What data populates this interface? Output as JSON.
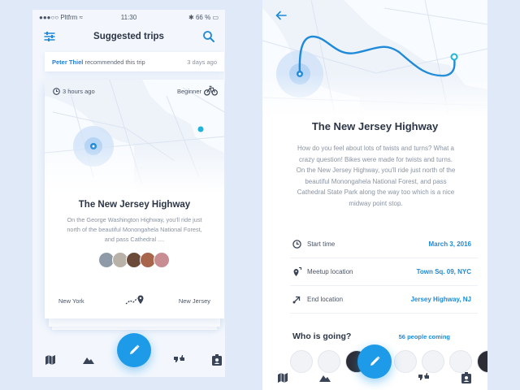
{
  "colors": {
    "accent": "#1e9be8",
    "link": "#1e7cd6",
    "background": "#dfe9f8"
  },
  "left_screen": {
    "status_bar": {
      "carrier": "Pltfrm",
      "time": "11:30",
      "battery": "66 %"
    },
    "header": {
      "title": "Suggested trips",
      "left_icon": "filter-icon",
      "right_icon": "search-icon"
    },
    "recommendation": {
      "name": "Peter Thiel",
      "text": "recommended this trip",
      "time": "3 days ago"
    },
    "trip_card": {
      "duration": "3 hours ago",
      "level": "Beginner",
      "title": "The New Jersey Highway",
      "description": "On the George Washington Highway, you'll ride just north of the beautiful Monongahela National Forest, and pass Cathedral ....",
      "from": "New York",
      "to": "New Jersey",
      "avatar_count": 5
    },
    "tab_icons": [
      "map-icon",
      "mountain-icon",
      "compose-icon",
      "thumbs-icon",
      "profile-badge-icon"
    ]
  },
  "right_screen": {
    "title": "The New Jersey Highway",
    "description": "How do you feel about lots of twists and turns? What a crazy question! Bikes were made for twists and turns. On the New Jersey Highway, you'll ride just north of the beautiful Monongahela National Forest, and pass Cathedral State Park along the way too which is a nice midway point stop.",
    "details": [
      {
        "label": "Start time",
        "value": "March 3, 2016",
        "icon": "clock-icon"
      },
      {
        "label": "Meetup location",
        "value": "Town Sq. 09, NYC",
        "icon": "meetup-pin-icon"
      },
      {
        "label": "End location",
        "value": "Jersey Highway, NJ",
        "icon": "end-arrow-icon"
      }
    ],
    "going": {
      "label": "Who is going?",
      "count": "56 people coming"
    }
  }
}
